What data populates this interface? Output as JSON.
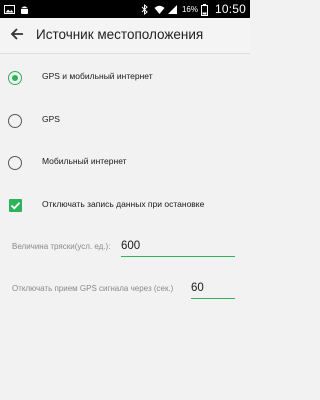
{
  "status_bar": {
    "battery_percent": "16%",
    "time": "10:50",
    "left_icons": [
      "image-icon",
      "android-icon"
    ],
    "right_icons": [
      "bluetooth-icon",
      "wifi-icon",
      "signal-icon",
      "battery-icon"
    ]
  },
  "app_bar": {
    "back_icon": "arrow-left-icon",
    "title": "Источник местоположения"
  },
  "options": [
    {
      "type": "radio",
      "label": "GPS и мобильный интернет",
      "checked": true
    },
    {
      "type": "radio",
      "label": "GPS",
      "checked": false
    },
    {
      "type": "radio",
      "label": "Мобильный интернет",
      "checked": false
    },
    {
      "type": "checkbox",
      "label": "Отключать запись данных при остановке",
      "checked": true
    }
  ],
  "fields": {
    "shake": {
      "label": "Величина тряски(усл. ед.):",
      "value": "600"
    },
    "gps_off": {
      "label": "Отключать прием GPS сигнала через (сек.)",
      "value": "60"
    }
  },
  "colors": {
    "accent": "#2fb35a",
    "status_bar": "#000000",
    "background": "#f2f2f2"
  }
}
